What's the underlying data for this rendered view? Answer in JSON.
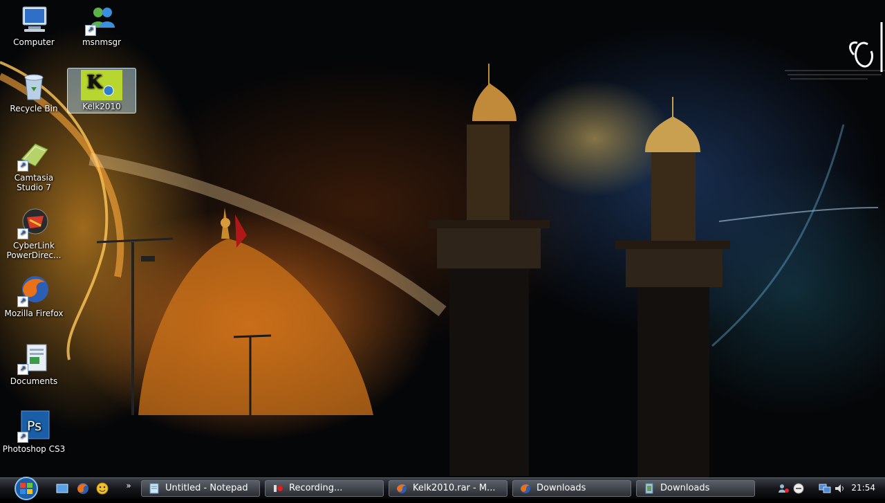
{
  "desktop": {
    "icons": [
      {
        "label": "Computer",
        "icon": "computer-icon"
      },
      {
        "label": "msnmsgr",
        "icon": "msn-messenger-icon"
      },
      {
        "label": "Recycle Bin",
        "icon": "recycle-bin-icon"
      },
      {
        "label": "Kelk2010",
        "icon": "kelk2010-icon"
      },
      {
        "label": "Camtasia Studio 7",
        "icon": "camtasia-icon"
      },
      {
        "label": "CyberLink PowerDirec...",
        "icon": "cyberlink-icon"
      },
      {
        "label": "Mozilla Firefox",
        "icon": "firefox-icon"
      },
      {
        "label": "Documents",
        "icon": "documents-icon"
      },
      {
        "label": "Photoshop CS3",
        "icon": "photoshop-icon"
      }
    ],
    "photoshop_glyph": "Ps",
    "kelk_glyph": "K"
  },
  "taskbar": {
    "quick_launch_more": "»",
    "buttons": [
      {
        "label": "Untitled - Notepad",
        "icon": "notepad-icon"
      },
      {
        "label": "Recording...",
        "icon": "recording-icon"
      },
      {
        "label": "Kelk2010.rar - M...",
        "icon": "firefox-icon"
      },
      {
        "label": "Downloads",
        "icon": "firefox-icon"
      },
      {
        "label": "Downloads",
        "icon": "folder-icon"
      }
    ],
    "clock": "21:54"
  },
  "colors": {
    "selection": "#c8f0ff",
    "taskbar": "#15171b",
    "firefox_orange": "#e8711a",
    "photoshop_blue": "#1b5ea8"
  }
}
